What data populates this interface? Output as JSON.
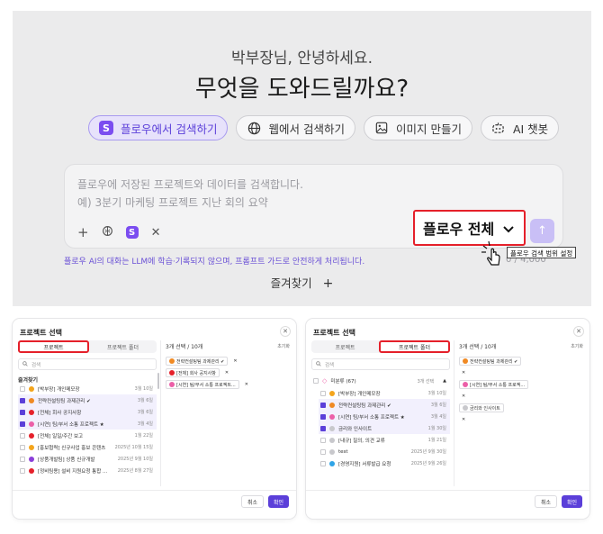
{
  "hero": {
    "greeting": "박부장님, 안녕하세요.",
    "question": "무엇을 도와드릴까요?",
    "modes": [
      {
        "label": "플로우에서 검색하기",
        "icon": "flow-logo-icon",
        "active": true
      },
      {
        "label": "웹에서 검색하기",
        "icon": "globe-icon"
      },
      {
        "label": "이미지 만들기",
        "icon": "image-icon"
      },
      {
        "label": "AI 챗봇",
        "icon": "chatbot-icon"
      }
    ],
    "input": {
      "placeholder_line1": "플로우에 저장된 프로젝트와 데이터를 검색합니다.",
      "placeholder_line2": "예) 3분기 마케팅 프로젝트 지난 회의 요약"
    },
    "scope_label": "플로우 전체",
    "tooltip": "플로우 검색 범위 설정",
    "counter": "0 / 4,000",
    "disclaimer": "플로우 AI의 대화는 LLM에 학습·기록되지 않으며, 프롬프트 가드로 안전하게 처리됩니다.",
    "favorites_label": "즐겨찾기",
    "accent": "#5b3fd9",
    "highlight": "#e5202a"
  },
  "modal1": {
    "title": "프로젝트 선택",
    "tabs": [
      "프로젝트",
      "프로젝트 폴더"
    ],
    "search_placeholder": "검색",
    "section": "즐겨찾기",
    "rows": [
      {
        "name": "[박부장] 개인메모장",
        "date": "3월 10일",
        "color": "#f4a51c",
        "checked": false
      },
      {
        "name": "전략컨설팅팀 과제관리 ✔",
        "date": "3월 6일",
        "color": "#f08a24",
        "checked": true
      },
      {
        "name": "[전체] 회사 공지사항",
        "date": "3월 6일",
        "color": "#e5202a",
        "checked": true
      },
      {
        "name": "[시연] 팀/부서 소통 프로젝트 ★",
        "date": "3월 4일",
        "color": "#ec5fa8",
        "checked": true
      },
      {
        "name": "[전체] 일일/주간 보고",
        "date": "1월 22일",
        "color": "#e5202a",
        "checked": false
      },
      {
        "name": "[홍보협력] 신규사업 홍보 콘텐츠",
        "date": "2025년 10월 15일",
        "color": "#f4a51c",
        "checked": false
      },
      {
        "name": "[상품개발팀] 상품 신규개발",
        "date": "2025년 9월 10일",
        "color": "#8b3fd9",
        "checked": false
      },
      {
        "name": "[정비팀용] 설비 지원요청 통합 ...",
        "date": "2025년 8월 27일",
        "color": "#e5202a",
        "checked": false
      }
    ],
    "selected_count": "3개 선택 / 10개",
    "reset": "초기화",
    "chips": [
      {
        "label": "전략컨설팅팀 과제관리 ✔",
        "color": "#f08a24"
      },
      {
        "label": "[전체] 회사 공지사항",
        "color": "#e5202a"
      },
      {
        "label": "[시연] 팀/부서 소통 프로젝트...",
        "color": "#ec5fa8"
      }
    ],
    "cancel": "취소",
    "confirm": "확인"
  },
  "modal2": {
    "title": "프로젝트 선택",
    "tabs": [
      "프로젝트",
      "프로젝트 폴더"
    ],
    "search_placeholder": "검색",
    "group": {
      "name": "미분류 (67)",
      "count": "3개 선택"
    },
    "rows": [
      {
        "name": "[박부장] 개인메모장",
        "date": "3월 10일",
        "color": "#f4a51c",
        "checked": false
      },
      {
        "name": "전략컨설팅팀 과제관리 ✔",
        "date": "3월 6일",
        "color": "#f08a24",
        "checked": true
      },
      {
        "name": "[시연] 팀/부서 소통 프로젝트 ★",
        "date": "3월 4일",
        "color": "#ec5fa8",
        "checked": true
      },
      {
        "name": "금리와 인사이트",
        "date": "1월 30일",
        "color": "#c8c8cc",
        "checked": true
      },
      {
        "name": "[내규] 질의, 의견 교류",
        "date": "1월 21일",
        "color": "#c8c8cc",
        "checked": false
      },
      {
        "name": "test",
        "date": "2025년 9월 30일",
        "color": "#c8c8cc",
        "checked": false
      },
      {
        "name": "[경영지원] 서류발급 요청",
        "date": "2025년 9월 26일",
        "color": "#2fa4e7",
        "checked": false
      }
    ],
    "selected_count": "3개 선택 / 10개",
    "reset": "초기화",
    "chips": [
      {
        "label": "전략컨설팅팀 과제관리 ✔",
        "color": "#f08a24"
      },
      {
        "label": "[시연] 팀/부서 소통 프로젝...",
        "color": "#ec5fa8"
      },
      {
        "label": "금리와 인사이트",
        "color": "#c8c8cc"
      }
    ],
    "cancel": "취소",
    "confirm": "확인"
  }
}
